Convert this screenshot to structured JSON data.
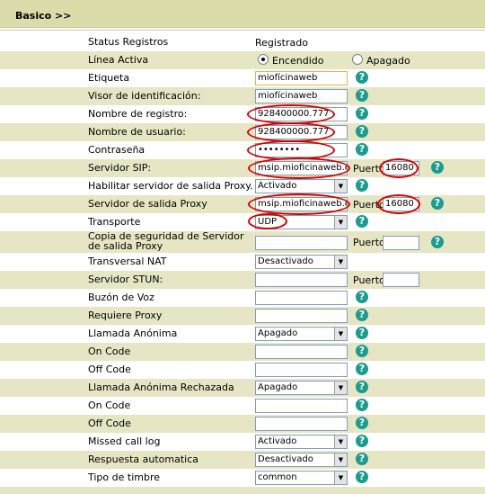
{
  "header": {
    "title": "Basico >>"
  },
  "port_label": "Puerto",
  "help_glyph": "?",
  "rows": {
    "status": {
      "label": "Status Registros",
      "value": "Registrado"
    },
    "linea": {
      "label": "Línea Activa",
      "option_on": "Encendido",
      "option_off": "Apagado",
      "selected": "Encendido"
    },
    "etiqueta": {
      "label": "Etiqueta",
      "value": "miofícinaweb"
    },
    "visor": {
      "label": "Visor de identificación:",
      "value": "miofícinaweb"
    },
    "registro": {
      "label": "Nombre de registro:",
      "value": "928400000.777"
    },
    "usuario": {
      "label": "Nombre de usuario:",
      "value": "928400000.777"
    },
    "contrasena": {
      "label": "Contraseña",
      "value": "••••••••"
    },
    "sip": {
      "label": "Servidor SIP:",
      "value": "msip.mioficinaweb.es",
      "port": "16080"
    },
    "habilitar_proxy": {
      "label": "Habilitar servidor de salida Proxy.",
      "value": "Activado"
    },
    "proxy": {
      "label": "Servidor de salida Proxy",
      "value": "msip.mioficinaweb.es",
      "port": "16080"
    },
    "transporte": {
      "label": "Transporte",
      "value": "UDP"
    },
    "copia_proxy": {
      "label": "Copia de seguridad de Servidor de salida Proxy",
      "value": "",
      "port": ""
    },
    "nat": {
      "label": "Transversal NAT",
      "value": "Desactivado"
    },
    "stun": {
      "label": "Servidor STUN:",
      "value": "",
      "port": ""
    },
    "buzon": {
      "label": "Buzón de Voz",
      "value": ""
    },
    "requiere_proxy": {
      "label": "Requiere Proxy",
      "value": ""
    },
    "anonima": {
      "label": "Llamada Anónima",
      "value": "Apagado"
    },
    "on_code_1": {
      "label": "On Code",
      "value": ""
    },
    "off_code_1": {
      "label": "Off Code",
      "value": ""
    },
    "anonima_rechazada": {
      "label": "Llamada Anónima Rechazada",
      "value": "Apagado"
    },
    "on_code_2": {
      "label": "On Code",
      "value": ""
    },
    "off_code_2": {
      "label": "Off Code",
      "value": ""
    },
    "missed": {
      "label": "Missed call log",
      "value": "Activado"
    },
    "respuesta": {
      "label": "Respuesta automatica",
      "value": "Desactivado"
    },
    "timbre": {
      "label": "Tipo de timbre",
      "value": "common"
    }
  }
}
